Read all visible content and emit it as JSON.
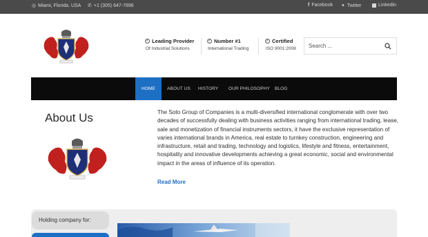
{
  "topbar": {
    "location": "Miami, Florida. USA",
    "phone": "+1 (305) 647-7896",
    "social": [
      {
        "label": "Facebook",
        "icon": "facebook-icon"
      },
      {
        "label": "Twitter",
        "icon": "twitter-icon"
      },
      {
        "label": "Linkedin",
        "icon": "linkedin-icon"
      }
    ]
  },
  "header": {
    "features": [
      {
        "title": "Leading Provider",
        "subtitle": "Of Industrial Solutions"
      },
      {
        "title": "Number #1",
        "subtitle": "International Trading"
      },
      {
        "title": "Certified",
        "subtitle": "ISO 9001:2008"
      }
    ],
    "search_placeholder": "Search ..."
  },
  "nav": {
    "items": [
      {
        "label": "HOME",
        "active": true
      },
      {
        "label": "ABOUT US",
        "active": false
      },
      {
        "label": "HISTORY",
        "active": false
      },
      {
        "label": "OUR PHILOSOPHY",
        "active": false
      },
      {
        "label": "BLOG",
        "active": false
      }
    ]
  },
  "about": {
    "title": "About Us",
    "text": "The Soto Group of Companies is a multi-diversified international conglomerate with over two decades of successfully dealing with business activities ranging from international trading, lease, sale and monetization of financial instruments sectors, it have the exclusive representation of varies international brands in America, real estate to turnkey construction, engineering and infrastructure, retail and trading, technology and logistics, lifestyle and fitness, entertainment, hospitality and innovative developments achieving a great economic, social and environmental impact in the areas of influence of its operation.",
    "read_more": "Read More"
  },
  "holding": {
    "label": "Holding company for:"
  },
  "colors": {
    "accent": "#1d6fc4",
    "topbar": "#4a4a4a",
    "nav": "#0b0b0b"
  }
}
